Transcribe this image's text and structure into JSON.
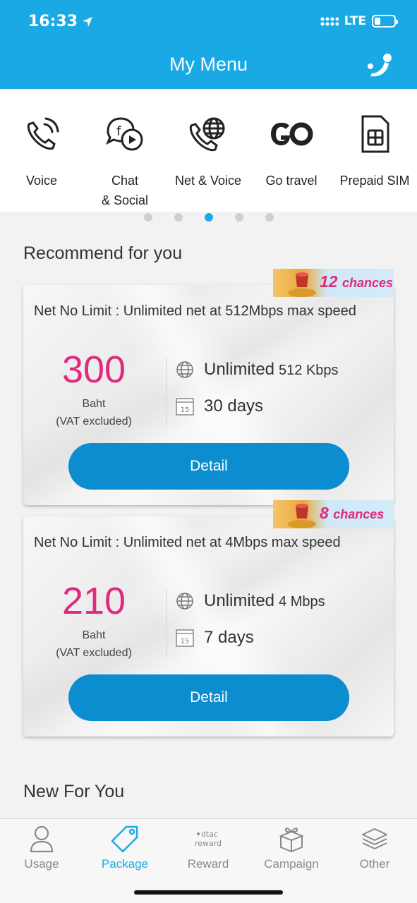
{
  "status_bar": {
    "time": "16:33",
    "network": "LTE"
  },
  "header": {
    "title": "My Menu"
  },
  "menu": [
    {
      "label": "Voice",
      "icon": "phone-wave-icon"
    },
    {
      "label": "Chat\n& Social",
      "icon": "chat-social-icon"
    },
    {
      "label": "Net & Voice",
      "icon": "phone-globe-icon"
    },
    {
      "label": "Go travel",
      "icon": "go-icon"
    },
    {
      "label": "Prepaid SIM",
      "icon": "sim-card-icon"
    }
  ],
  "pager": {
    "count": 5,
    "active_index": 2
  },
  "recommend": {
    "title": "Recommend for you",
    "packages": [
      {
        "badge_number": "12",
        "badge_word": "chances",
        "name": "Net No Limit : Unlimited net at 512Mbps max speed",
        "price": "300",
        "currency": "Baht",
        "vat_note": "(VAT excluded)",
        "data_main": "Unlimited",
        "data_speed": "512 Kbps",
        "calendar_day": "15",
        "duration": "30 days",
        "button": "Detail"
      },
      {
        "badge_number": "8",
        "badge_word": "chances",
        "name": "Net No Limit : Unlimited net at 4Mbps max speed",
        "price": "210",
        "currency": "Baht",
        "vat_note": "(VAT excluded)",
        "data_main": "Unlimited",
        "data_speed": "4 Mbps",
        "calendar_day": "15",
        "duration": "7 days",
        "button": "Detail"
      }
    ]
  },
  "new_for_you": {
    "title": "New For You"
  },
  "tabbar": [
    {
      "label": "Usage",
      "icon": "user-icon",
      "active": false
    },
    {
      "label": "Package",
      "icon": "tag-icon",
      "active": true
    },
    {
      "label": "Reward",
      "icon": "dtac-reward-icon",
      "active": false,
      "icon_text_1": "dtac",
      "icon_text_2": "reward"
    },
    {
      "label": "Campaign",
      "icon": "gift-box-icon",
      "active": false
    },
    {
      "label": "Other",
      "icon": "layers-icon",
      "active": false
    }
  ],
  "colors": {
    "brand": "#19aae6",
    "button": "#0b8dd0",
    "price": "#e0297f"
  }
}
